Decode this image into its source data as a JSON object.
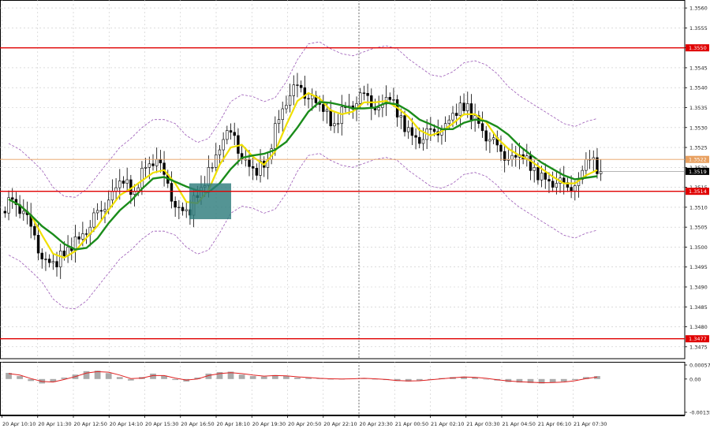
{
  "chart_data": [
    {
      "type": "candlestick",
      "instrument_visible": false,
      "xlim": [
        0,
        1
      ],
      "ylim": [
        1.3472,
        1.3562
      ],
      "y_ticks": [
        1.3475,
        1.348,
        1.3485,
        1.349,
        1.3495,
        1.35,
        1.3505,
        1.351,
        1.3515,
        1.352,
        1.3525,
        1.353,
        1.3535,
        1.354,
        1.3545,
        1.355,
        1.3555,
        1.356
      ],
      "y_tick_labels": [
        "1.3475",
        "1.3480",
        "1.3485",
        "1.3490",
        "1.3495",
        "1.3500",
        "1.3505",
        "1.3510",
        "1.3515",
        "1.3520",
        "1.3525",
        "1.3530",
        "1.3535",
        "1.3540",
        "1.3545",
        "1.3550",
        "1.3555",
        "1.3560"
      ],
      "x_tick_labels": [
        "20 Apr 10:10",
        "20 Apr 11:30",
        "20 Apr 12:50",
        "20 Apr 14:10",
        "20 Apr 15:30",
        "20 Apr 16:50",
        "20 Apr 18:10",
        "20 Apr 19:30",
        "20 Apr 20:50",
        "20 Apr 22:10",
        "20 Apr 23:30",
        "21 Apr 00:50",
        "21 Apr 02:10",
        "21 Apr 03:30",
        "21 Apr 04:50",
        "21 Apr 06:10",
        "21 Apr 07:30"
      ],
      "horizontal_levels": [
        {
          "value": 1.355,
          "label": "1.3550",
          "color": "#e00000"
        },
        {
          "value": 1.3514,
          "label": "1.3514",
          "color": "#e00000"
        },
        {
          "value": 1.3477,
          "label": "1.3477",
          "color": "#e00000"
        },
        {
          "value": 1.3522,
          "label": "1.3522",
          "color": "#e8a060"
        }
      ],
      "current_price": {
        "value": 1.3519,
        "label": "1.3519"
      },
      "vertical_separator_at_label": "20 Apr 23:30",
      "highlight_box": {
        "price_top": 1.3516,
        "price_bottom": 1.3507,
        "color": "#2e7d7d"
      },
      "close_series": [
        1.3512,
        1.3509,
        1.3503,
        1.3497,
        1.3495,
        1.35,
        1.3502,
        1.3505,
        1.3509,
        1.3514,
        1.3516,
        1.3514,
        1.352,
        1.3522,
        1.3516,
        1.351,
        1.3508,
        1.3515,
        1.352,
        1.3527,
        1.3528,
        1.3522,
        1.3518,
        1.3522,
        1.3532,
        1.3538,
        1.354,
        1.3538,
        1.3534,
        1.3531,
        1.3535,
        1.3536,
        1.3538,
        1.3535,
        1.3537,
        1.3533,
        1.3528,
        1.3527,
        1.3529,
        1.3531,
        1.3533,
        1.3536,
        1.3531,
        1.3527,
        1.3524,
        1.3523,
        1.3522,
        1.352,
        1.3517,
        1.3516,
        1.3515,
        1.3517,
        1.3522,
        1.3519
      ],
      "series": [
        {
          "name": "",
          "color": "#f0e000",
          "role": "moving-average-fast"
        },
        {
          "name": "",
          "color": "#1a8c1a",
          "role": "moving-average-slow"
        },
        {
          "name": "",
          "color": "#9b59b6",
          "role": "envelope-band-dashed"
        }
      ],
      "candle_up_color": "#ffffff",
      "candle_down_color": "#000000"
    },
    {
      "type": "histogram",
      "ylim": [
        -0.00135,
        0.00057
      ],
      "y_ticks": [
        0.00057,
        0.0,
        -0.00135
      ],
      "y_tick_labels": [
        "0.00057",
        "0.00",
        "-0.00135"
      ],
      "histogram_color": "#aaaaaa",
      "signal_color": "#e02020",
      "histogram_values": [
        0.00025,
        0.00012,
        -8e-05,
        -0.00018,
        -0.00012,
        6e-05,
        0.00018,
        0.00032,
        0.00034,
        0.00024,
        8e-05,
        -6e-05,
        8e-05,
        0.00022,
        0.00014,
        -4e-05,
        -0.0001,
        6e-05,
        0.00022,
        0.00028,
        0.0003,
        0.00018,
        0.00012,
        0.0001,
        0.00016,
        0.00012,
        6e-05,
        4e-05,
        2e-05,
        0.0,
        0.0,
        2e-05,
        4e-05,
        0.0,
        -4e-05,
        -8e-05,
        -0.0001,
        -6e-05,
        0.0,
        4e-05,
        8e-05,
        0.0001,
        6e-05,
        0.0,
        -6e-05,
        -0.00012,
        -0.00014,
        -0.00016,
        -0.00018,
        -0.00014,
        -0.0001,
        -4e-05,
        8e-05,
        0.00012
      ],
      "signal_values": [
        0.00022,
        0.00016,
        2e-05,
        -0.0001,
        -0.00012,
        -2e-05,
        0.0001,
        0.00024,
        0.0003,
        0.00028,
        0.00016,
        2e-05,
        4e-05,
        0.00014,
        0.00014,
        4e-05,
        -4e-05,
        0.0,
        0.00014,
        0.00022,
        0.00026,
        0.00022,
        0.00016,
        0.00012,
        0.00014,
        0.00013,
        9e-05,
        6e-05,
        3e-05,
        1e-05,
        0.0,
        1e-05,
        3e-05,
        1e-05,
        -2e-05,
        -6e-05,
        -8e-05,
        -7e-05,
        -3e-05,
        1e-05,
        5e-05,
        8e-05,
        7e-05,
        3e-05,
        -3e-05,
        -8e-05,
        -0.00011,
        -0.00013,
        -0.00015,
        -0.00014,
        -0.00012,
        -7e-05,
        2e-05,
        8e-05
      ]
    }
  ]
}
